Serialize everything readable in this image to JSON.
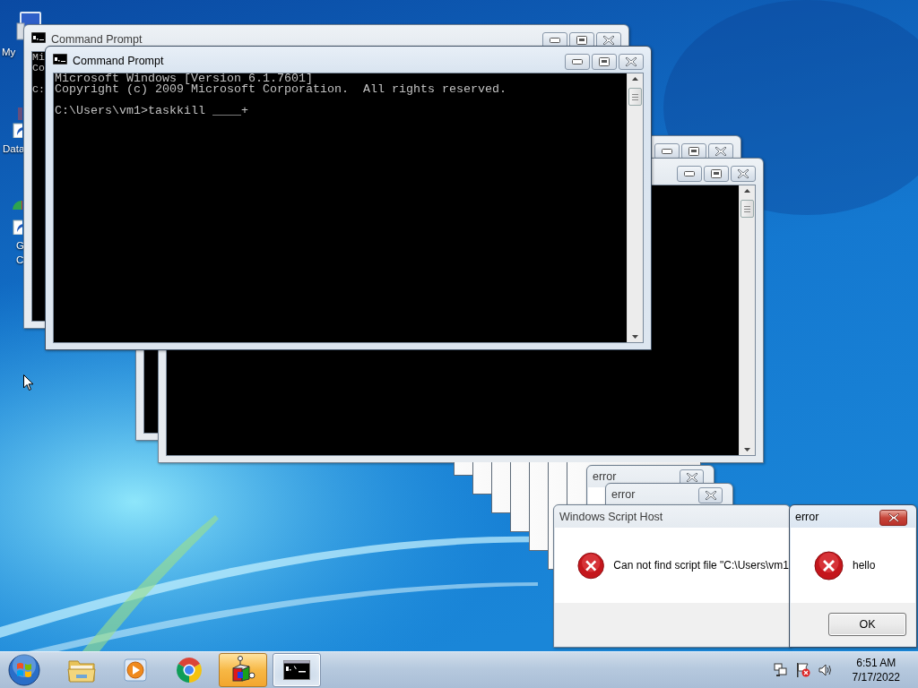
{
  "desktop_icons": [
    {
      "kind": "computer",
      "lines": [
        "My"
      ]
    },
    {
      "kind": "shortcut",
      "lines": [
        "Data"
      ]
    },
    {
      "kind": "browser-shortcut",
      "lines": [
        "G",
        "C"
      ]
    }
  ],
  "consoles": [
    {
      "title": "Command Prompt",
      "active": false,
      "blocks": [
        [
          "Mi",
          "Co"
        ],
        [
          "C:"
        ]
      ]
    },
    {
      "active": false
    },
    {
      "active": false
    },
    {
      "title": "Command Prompt",
      "active": true,
      "blocks": [
        [
          "Microsoft Windows [Version 6.1.7601]",
          "Copyright (c) 2009 Microsoft Corporation.  All rights reserved."
        ],
        [
          "C:\\Users\\vm1>taskkill ____+"
        ]
      ]
    }
  ],
  "dialogs": [
    {
      "kind": "blank"
    },
    {
      "kind": "blank"
    },
    {
      "kind": "blank"
    },
    {
      "kind": "blank"
    },
    {
      "kind": "blank"
    },
    {
      "kind": "blank"
    },
    {
      "kind": "blank"
    },
    {
      "kind": "titled",
      "title": "error",
      "active": false
    },
    {
      "kind": "titled",
      "title": "error",
      "active": false
    },
    {
      "kind": "message",
      "title": "Windows Script Host",
      "message": "Can not find script file \"C:\\Users\\vm1",
      "active": false
    },
    {
      "kind": "message",
      "title": "error",
      "message": "hello",
      "button": "OK",
      "active": true
    }
  ],
  "taskbar": {
    "items": [
      {
        "kind": "folder",
        "flashing": false,
        "selected": false
      },
      {
        "kind": "media",
        "flashing": false,
        "selected": false
      },
      {
        "kind": "browser",
        "flashing": false,
        "selected": false
      },
      {
        "kind": "cube",
        "flashing": true,
        "selected": false
      },
      {
        "kind": "terminal",
        "flashing": false,
        "selected": true
      }
    ],
    "clock": {
      "time": "6:51 AM",
      "date": "7/17/2022"
    }
  }
}
